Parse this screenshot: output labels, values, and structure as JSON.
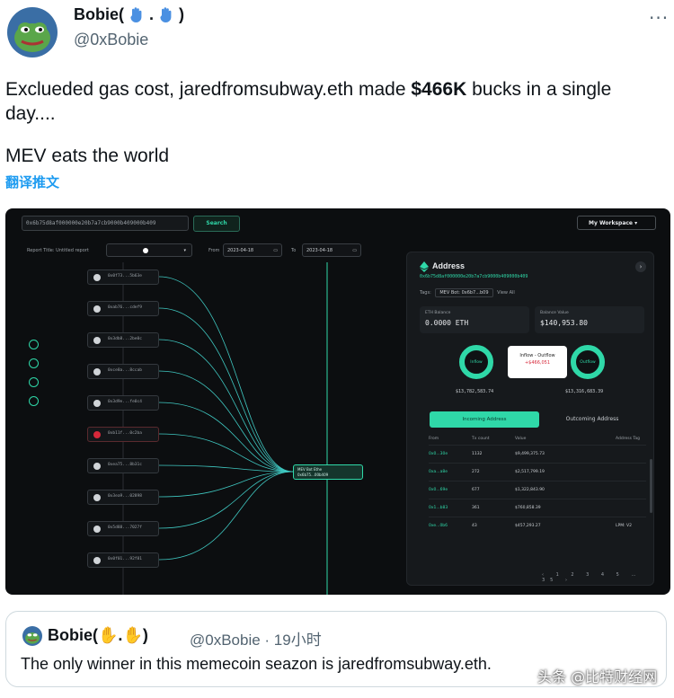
{
  "tweet": {
    "author_name": "Bobie(",
    "author_name_end": ")",
    "handle": "@0xBobie",
    "text_part1": "Exclueded gas cost, jaredfromsubway.eth made ",
    "text_amount": "$466K",
    "text_part2": " bucks in a single day....",
    "text_line2": "MEV eats the world",
    "translate_label": "翻译推文",
    "more_label": "···"
  },
  "dashboard": {
    "address_input": "0x6b75d8af000000e20b7a7cb9000b409000b409",
    "search_label": "Search",
    "workspace_label": "My Workspace ▾",
    "report_title_label": "Report Title: Untitled report",
    "from_label": "From",
    "from_date": "2023-04-18",
    "to_label": "To",
    "to_date": "2023-04-18",
    "center_node_line1": "MEV Bot Ethe",
    "center_node_line2": "0x6b75...00b409",
    "nodes": [
      "0x0f73...5b63e",
      "0xab76...cdef9",
      "0x3db8...2be0c",
      "0xce8a...8ccab",
      "0x3d9e...fe0c4",
      "0xb11f...0c2ba",
      "0xea75...8b31c",
      "0x3ea9...02898",
      "0x5d88...7027f",
      "0x0f01...92f81"
    ],
    "panel": {
      "title": "Address",
      "hash": "0x6b75d8af000000e20b7a7cb9000b409000b409",
      "tag_label": "Tags:",
      "tag_value": "MEV Bot: 0x6b7...b09",
      "view_all": "View All",
      "eth_balance_label": "ETH Balance",
      "eth_balance": "0.0000 ETH",
      "balance_value_label": "Balance Value",
      "balance_value": "$140,953.80",
      "inflow_label": "Inflow",
      "outflow_label": "Outflow",
      "flow_title": "Inflow - Outflow",
      "flow_value": "+$466,051",
      "inflow_value": "$13,782,583.74",
      "outflow_value": "$13,316,683.39",
      "tab_incoming": "Incoming Address",
      "tab_outgoing": "Outcoming Address",
      "columns": [
        "From",
        "Tx count",
        "Value",
        "Address Tag"
      ],
      "rows": [
        [
          "0x0...30e",
          "1132",
          "$9,499,375.73",
          ""
        ],
        [
          "0xa...a8e",
          "272",
          "$2,517,799.19",
          ""
        ],
        [
          "0x0...69e",
          "677",
          "$1,322,843.90",
          ""
        ],
        [
          "0x1...b83",
          "361",
          "$760,858.39",
          ""
        ],
        [
          "0xe...0b6",
          "43",
          "$457,293.27",
          "LPM: V2"
        ]
      ],
      "pager": "‹ 1 2 3 4 5 … 35 ›"
    }
  },
  "quote": {
    "author_name": "Bobie(",
    "author_name_end": ")",
    "handle_time": "@0xBobie · 19小时",
    "text": "The only winner in this memecoin seazon is jaredfromsubway.eth."
  },
  "watermark": "头条 @比特财经网"
}
